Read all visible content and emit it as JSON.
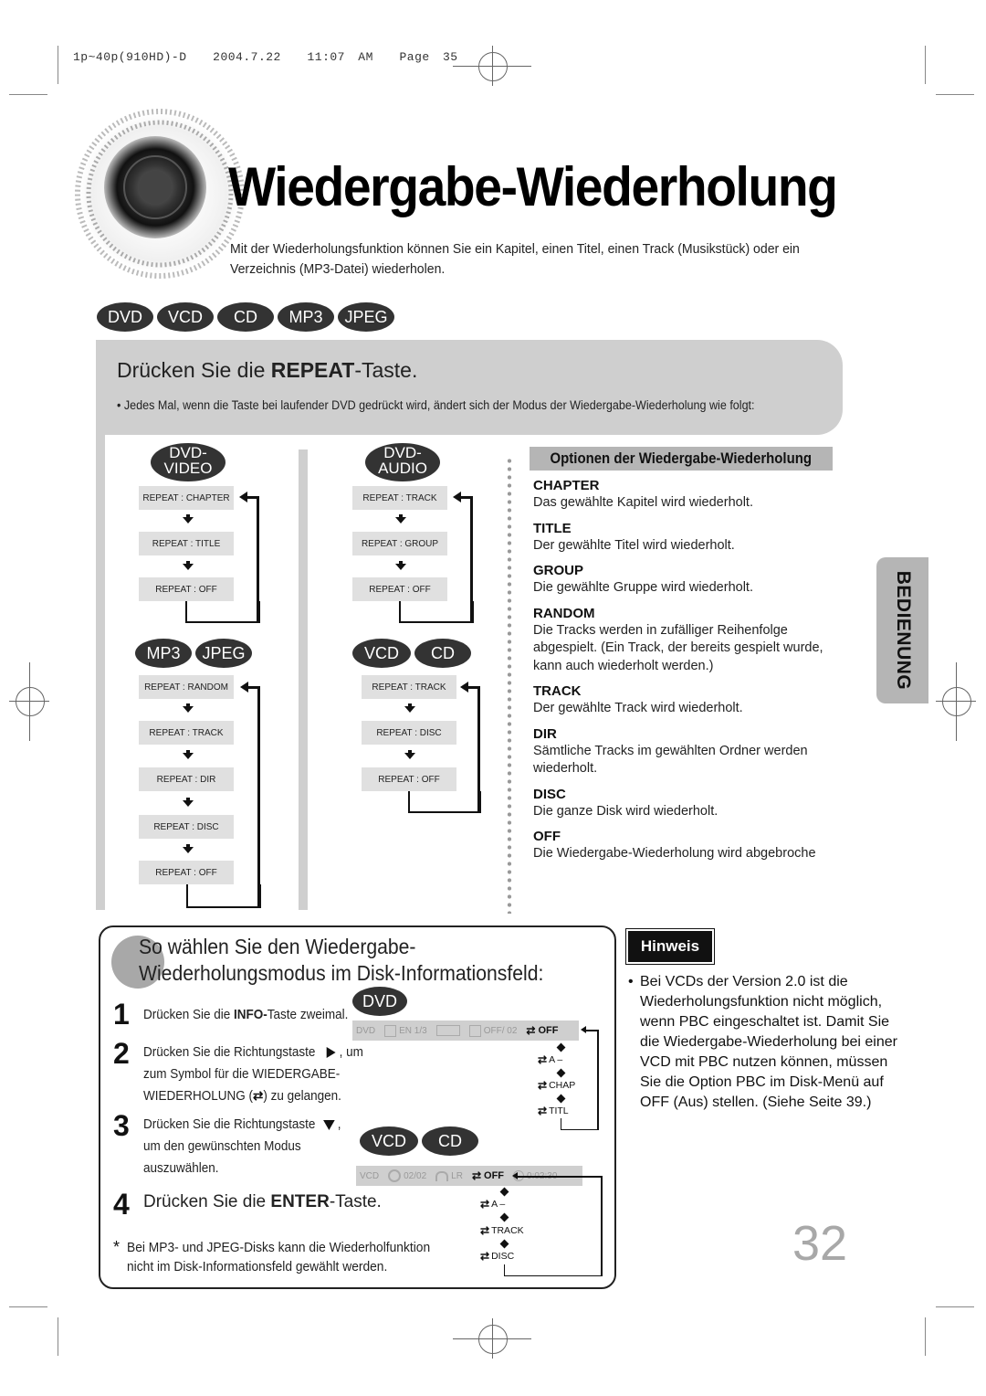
{
  "print_header": {
    "job": "1p~40p(910HD)-D",
    "date": "2004.7.22",
    "time": "11:07 AM",
    "page_label": "Page 35"
  },
  "title": "Wiedergabe-Wiederholung",
  "intro": "Mit der Wiederholungsfunktion können Sie ein Kapitel, einen Titel, einen Track (Musikstück) oder ein Verzeichnis (MP3-Datei) wiederholen.",
  "disc_types": [
    "DVD",
    "VCD",
    "CD",
    "MP3",
    "JPEG"
  ],
  "step": {
    "title_prefix": "Drücken Sie die ",
    "title_bold": "REPEAT",
    "title_suffix": "-Taste.",
    "bullet": "• Jedes Mal, wenn die Taste bei laufender DVD gedrückt wird, ändert sich der Modus der Wiedergabe-Wiederholung wie folgt:"
  },
  "flows": {
    "dvd_video": {
      "label_line1": "DVD-",
      "label_line2": "VIDEO",
      "items": [
        "REPEAT : CHAPTER",
        "REPEAT : TITLE",
        "REPEAT : OFF"
      ]
    },
    "dvd_audio": {
      "label_line1": "DVD-",
      "label_line2": "AUDIO",
      "items": [
        "REPEAT : TRACK",
        "REPEAT : GROUP",
        "REPEAT : OFF"
      ]
    },
    "mp3_jpeg": {
      "labels": [
        "MP3",
        "JPEG"
      ],
      "items": [
        "REPEAT : RANDOM",
        "REPEAT : TRACK",
        "REPEAT : DIR",
        "REPEAT : DISC",
        "REPEAT : OFF"
      ]
    },
    "vcd_cd": {
      "labels": [
        "VCD",
        "CD"
      ],
      "items": [
        "REPEAT : TRACK",
        "REPEAT : DISC",
        "REPEAT : OFF"
      ]
    }
  },
  "options": {
    "header": "Optionen der Wiedergabe-Wiederholung",
    "items": [
      {
        "name": "CHAPTER",
        "desc": "Das gewählte Kapitel wird wiederholt."
      },
      {
        "name": "TITLE",
        "desc": "Der gewählte Titel wird wiederholt."
      },
      {
        "name": "GROUP",
        "desc": "Die gewählte Gruppe wird wiederholt."
      },
      {
        "name": "RANDOM",
        "desc": "Die Tracks werden in zufälliger Reihenfolge abgespielt. (Ein Track, der bereits gespielt wurde, kann auch wiederholt werden.)"
      },
      {
        "name": "TRACK",
        "desc": "Der gewählte Track wird wiederholt."
      },
      {
        "name": "DIR",
        "desc": "Sämtliche Tracks im gewählten Ordner werden wiederholt."
      },
      {
        "name": "DISC",
        "desc": "Die ganze Disk wird wiederholt."
      },
      {
        "name": "OFF",
        "desc": "Die Wiedergabe-Wiederholung wird abgebroche"
      }
    ]
  },
  "side_tab": "BEDIENUNG",
  "info_section": {
    "title": "So wählen Sie den Wiedergabe-Wiederholungsmodus im Disk-Informationsfeld:",
    "steps": [
      {
        "num": "1",
        "pre": "Drücken Sie die ",
        "bold": "INFO-",
        "post": "Taste zweimal."
      },
      {
        "num": "2",
        "line1": "Drücken Sie die Richtungstaste",
        "line1_end": ", um",
        "line2": "zum Symbol für die WIEDERGABE-",
        "line3_pre": "WIEDERHOLUNG (",
        "line3_post": ") zu gelangen."
      },
      {
        "num": "3",
        "line1": "Drücken Sie die Richtungstaste",
        "line1_end": ",",
        "line2": "um den gewünschten Modus",
        "line3": "auszuwählen."
      },
      {
        "num": "4",
        "pre": "Drücken Sie die ",
        "bold": "ENTER",
        "post": "-Taste."
      }
    ],
    "footnote_star": "*",
    "footnote": "Bei MP3- und JPEG-Disks kann die Wiederholfunktion nicht im Disk-Informationsfeld gewählt werden.",
    "dvd_label": "DVD",
    "dvd_osd": {
      "disc": "DVD",
      "audio": "EN 1/3",
      "subtitle": "OFF/ 02",
      "repeat": "OFF"
    },
    "dvd_modes": [
      "A –",
      "CHAP",
      "TITL"
    ],
    "vcd_labels": [
      "VCD",
      "CD"
    ],
    "vcd_osd": {
      "disc": "VCD",
      "track": "02/02",
      "audio": "LR",
      "repeat": "OFF",
      "time": "0:02:30"
    },
    "vcd_modes": [
      "A –",
      "TRACK",
      "DISC"
    ]
  },
  "hinweis": {
    "label": "Hinweis",
    "bullet": "•",
    "text": "Bei VCDs der Version 2.0 ist die Wiederholungsfunktion nicht möglich, wenn PBC eingeschaltet ist. Damit Sie die Wiedergabe-Wiederholung bei einer VCD mit PBC nutzen können, müssen Sie die Option PBC im Disk-Menü auf OFF (Aus) stellen. (Siehe Seite 39.)"
  },
  "page_number": "32",
  "icons": {
    "repeat": "repeat-icon",
    "right": "right-arrow-icon",
    "down": "down-arrow-icon"
  }
}
